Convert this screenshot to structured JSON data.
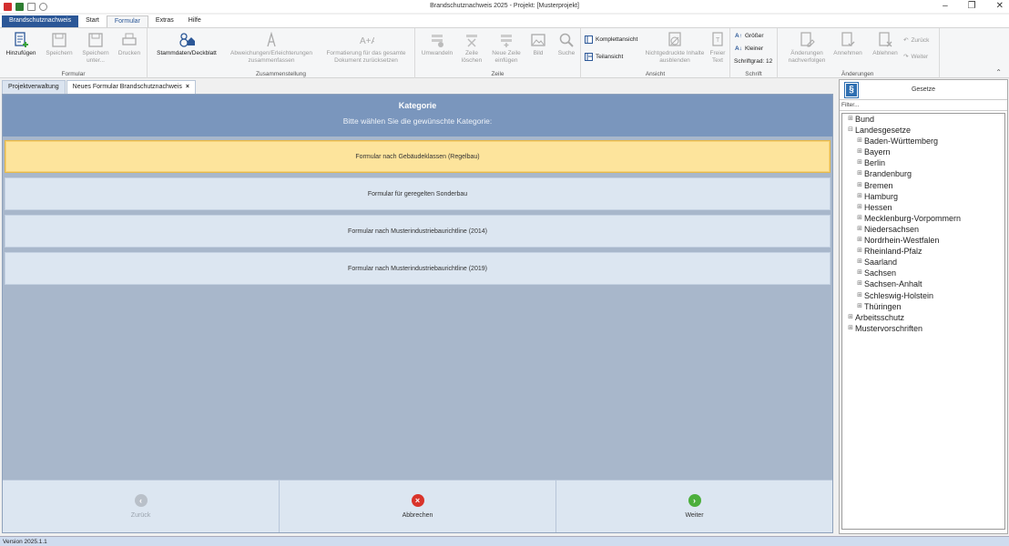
{
  "window": {
    "title": "Brandschutznachweis 2025 - Projekt: [Musterprojekt]"
  },
  "ribbon_tabs": [
    {
      "label": "Brandschutznachweis",
      "app": true,
      "active": false
    },
    {
      "label": "Start",
      "app": false,
      "active": false
    },
    {
      "label": "Formular",
      "app": false,
      "active": true
    },
    {
      "label": "Extras",
      "app": false,
      "active": false
    },
    {
      "label": "Hilfe",
      "app": false,
      "active": false
    }
  ],
  "ribbon": {
    "groups": {
      "formular": "Formular",
      "zusammenstellung": "Zusammenstellung",
      "zeile": "Zeile",
      "ansicht": "Ansicht",
      "schrift": "Schrift",
      "aenderungen": "Änderungen"
    },
    "buttons": {
      "hinzufuegen": "Hinzufügen",
      "speichern": "Speichern",
      "speichern_unter": "Speichern unter...",
      "drucken": "Drucken",
      "stammdaten": "Stammdaten/Deckblatt",
      "abweichungen": "Abweichungen/Erleichterungen zusammenfassen",
      "formatierung": "Formatierung für das gesamte Dokument zurücksetzen",
      "umwandeln": "Umwandeln",
      "zeile_loeschen": "Zeile löschen",
      "neue_zeile": "Neue Zeile einfügen",
      "bild": "Bild",
      "suche": "Suche",
      "komplettansicht": "Komplettansicht",
      "teilansicht": "Teilansicht",
      "nichtgedruckte": "Nichtgedruckte Inhalte ausblenden",
      "freier_text": "Freier Text",
      "groesser": "Größer",
      "kleiner": "Kleiner",
      "schriftgrad": "Schriftgrad: 12",
      "aenderungen_nachverfolgen": "Änderungen nachverfolgen",
      "annehmen": "Annehmen",
      "ablehnen": "Ablehnen",
      "zurueck": "Zurück",
      "weiter": "Weiter"
    }
  },
  "doc_tabs": [
    {
      "label": "Projektverwaltung",
      "active": false,
      "close": ""
    },
    {
      "label": "Neues Formular Brandschutznachweis",
      "active": true,
      "close": "×"
    }
  ],
  "main": {
    "header_title": "Kategorie",
    "header_subtitle": "Bitte wählen Sie die gewünschte Kategorie:",
    "categories": [
      {
        "label": "Formular nach Gebäudeklassen (Regelbau)",
        "selected": true
      },
      {
        "label": "Formular für geregelten Sonderbau",
        "selected": false
      },
      {
        "label": "Formular nach Musterindustriebaurichtline (2014)",
        "selected": false
      },
      {
        "label": "Formular nach Musterindustriebaurichtline (2019)",
        "selected": false
      }
    ],
    "footer": {
      "back": "Zurück",
      "cancel": "Abbrechen",
      "next": "Weiter"
    }
  },
  "right_panel": {
    "title": "Gesetze",
    "logo": "§",
    "filter_label": "Filter...",
    "tree": [
      {
        "label": "Bund",
        "level": 0,
        "toggle": "⊞"
      },
      {
        "label": "Landesgesetze",
        "level": 0,
        "toggle": "⊟"
      },
      {
        "label": "Baden-Württemberg",
        "level": 1,
        "toggle": "⊞"
      },
      {
        "label": "Bayern",
        "level": 1,
        "toggle": "⊞"
      },
      {
        "label": "Berlin",
        "level": 1,
        "toggle": "⊞"
      },
      {
        "label": "Brandenburg",
        "level": 1,
        "toggle": "⊞"
      },
      {
        "label": "Bremen",
        "level": 1,
        "toggle": "⊞"
      },
      {
        "label": "Hamburg",
        "level": 1,
        "toggle": "⊞"
      },
      {
        "label": "Hessen",
        "level": 1,
        "toggle": "⊞"
      },
      {
        "label": "Mecklenburg-Vorpommern",
        "level": 1,
        "toggle": "⊞"
      },
      {
        "label": "Niedersachsen",
        "level": 1,
        "toggle": "⊞"
      },
      {
        "label": "Nordrhein-Westfalen",
        "level": 1,
        "toggle": "⊞"
      },
      {
        "label": "Rheinland-Pfalz",
        "level": 1,
        "toggle": "⊞"
      },
      {
        "label": "Saarland",
        "level": 1,
        "toggle": "⊞"
      },
      {
        "label": "Sachsen",
        "level": 1,
        "toggle": "⊞"
      },
      {
        "label": "Sachsen-Anhalt",
        "level": 1,
        "toggle": "⊞"
      },
      {
        "label": "Schleswig-Holstein",
        "level": 1,
        "toggle": "⊞"
      },
      {
        "label": "Thüringen",
        "level": 1,
        "toggle": "⊞"
      },
      {
        "label": "Arbeitsschutz",
        "level": 0,
        "toggle": "⊞"
      },
      {
        "label": "Mustervorschriften",
        "level": 0,
        "toggle": "⊞"
      }
    ]
  },
  "status": {
    "version": "Version 2025.1.1"
  },
  "colors": {
    "accent": "#2b5797",
    "header_blue": "#7a96bd",
    "selected_yellow": "#fde49c",
    "cancel_red": "#d9342b",
    "next_green": "#4caf3c"
  }
}
